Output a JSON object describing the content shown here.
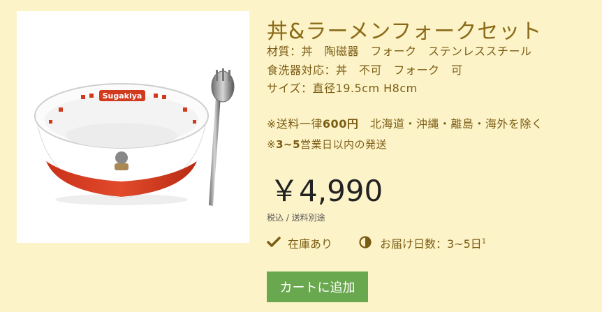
{
  "product": {
    "title": "丼&ラーメンフォークセット",
    "material": "材質：丼　陶磁器　フォーク　ステンレススチール",
    "dishwasher": "食洗器対応：丼　不可　フォーク　可",
    "size": "サイズ：直径19.5cm H8cm",
    "image_label": "Sugakiya"
  },
  "shipping": {
    "fee_prefix": "※送料一律",
    "fee_amount": "600円",
    "fee_note": "　北海道・沖縄・離島・海外を除く",
    "days_prefix": "※",
    "days_bold": "3~5",
    "days_suffix": "営業日以内の発送"
  },
  "price": {
    "amount": "￥4,990",
    "tax_note": "税込 / 送料別途"
  },
  "status": {
    "stock": "在庫あり",
    "delivery_label": "お届け日数：3~5日",
    "footnote": "1"
  },
  "actions": {
    "add_to_cart": "カートに追加"
  },
  "colors": {
    "background": "#fdf3c8",
    "title": "#8a6a18",
    "button": "#6aa84f"
  },
  "icons": {
    "stock": "check-icon",
    "delivery": "half-circle-icon"
  }
}
